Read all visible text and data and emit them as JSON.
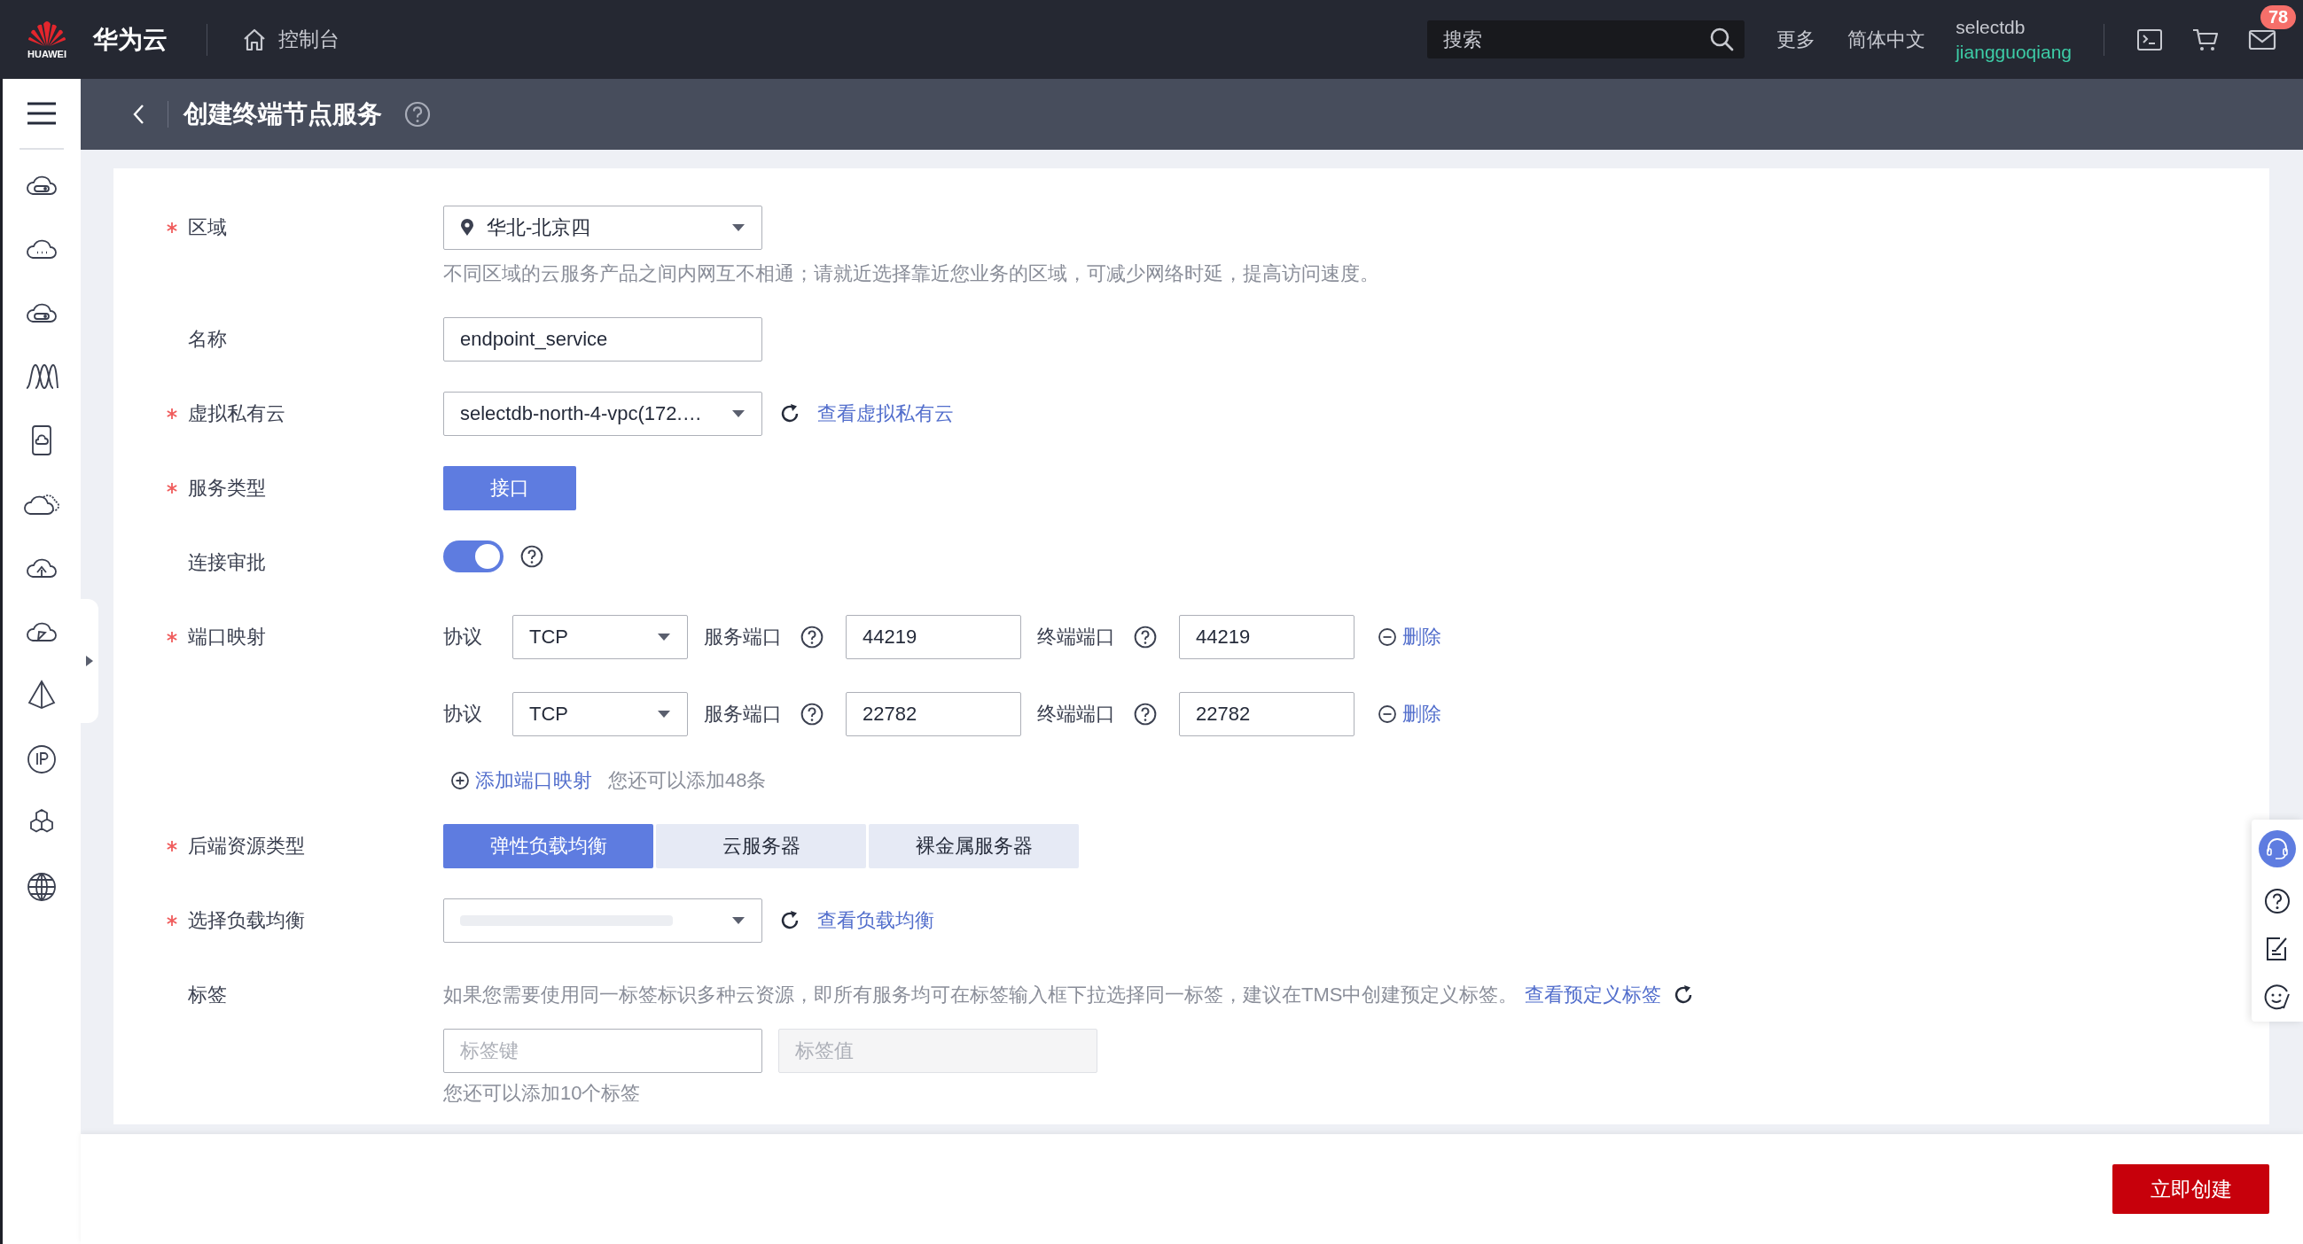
{
  "topbar": {
    "logo_text": "HUAWEI",
    "brand": "华为云",
    "console_link": "控制台",
    "search": {
      "placeholder": "搜索"
    },
    "links": [
      "更多",
      "简体中文"
    ],
    "account": {
      "name": "selectdb",
      "user": "jiangguoqiang"
    },
    "messages_badge": "78"
  },
  "page_header": {
    "title": "创建终端节点服务"
  },
  "fields": [
    {
      "kind": "select",
      "label": "区域",
      "required": true,
      "value": "华北-北京四",
      "location_pin": true,
      "hint": "不同区域的云服务产品之间内网互不相通；请就近选择靠近您业务的区域，可减少网络时延，提高访问速度。"
    },
    {
      "kind": "input",
      "label": "名称",
      "required": false,
      "value": "endpoint_service"
    },
    {
      "kind": "select",
      "label": "虚拟私有云",
      "required": true,
      "value": "selectdb-north-4-vpc(172.…",
      "refresh": true,
      "link": "查看虚拟私有云"
    },
    {
      "kind": "options",
      "label": "服务类型",
      "required": true,
      "options": [
        {
          "label": "接口",
          "selected": true
        }
      ]
    },
    {
      "kind": "switch",
      "label": "连接审批",
      "required": false,
      "on": true
    },
    {
      "kind": "ports",
      "label": "端口映射",
      "required": true,
      "rows": [
        {
          "protocol_label": "协议",
          "protocol": "TCP",
          "service_port_label": "服务端口",
          "service_port": "44219",
          "endpoint_port_label": "终端端口",
          "endpoint_port": "44219",
          "delete": "删除"
        },
        {
          "protocol_label": "协议",
          "protocol": "TCP",
          "service_port_label": "服务端口",
          "service_port": "22782",
          "endpoint_port_label": "终端端口",
          "endpoint_port": "22782",
          "delete": "删除"
        }
      ],
      "add_link": "添加端口映射",
      "add_note": "您还可以添加48条"
    },
    {
      "kind": "options",
      "label": "后端资源类型",
      "required": true,
      "options": [
        {
          "label": "弹性负载均衡",
          "selected": true
        },
        {
          "label": "云服务器",
          "selected": false
        },
        {
          "label": "裸金属服务器",
          "selected": false
        }
      ]
    },
    {
      "kind": "select",
      "label": "选择负载均衡",
      "required": true,
      "blurred": true,
      "refresh": true,
      "link": "查看负载均衡"
    },
    {
      "kind": "tags",
      "label": "标签",
      "required": false,
      "hint": "如果您需要使用同一标签标识多种云资源，即所有服务均可在标签输入框下拉选择同一标签，建议在TMS中创建预定义标签。",
      "link": "查看预定义标签",
      "key_placeholder": "标签键",
      "value_placeholder": "标签值",
      "value_disabled": true,
      "note": "您还可以添加10个标签"
    }
  ],
  "footer": {
    "submit": "立即创建"
  }
}
